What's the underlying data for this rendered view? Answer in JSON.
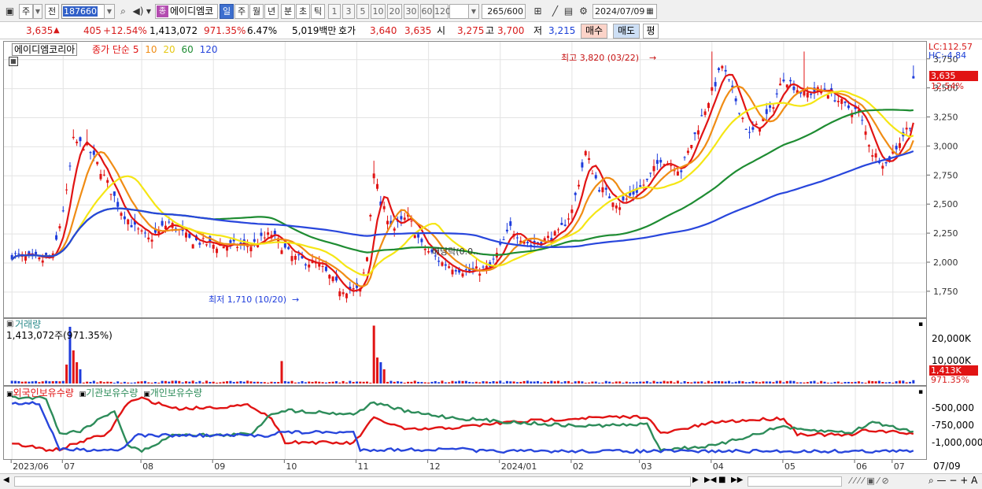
{
  "toolbar": {
    "mode_primary": "주",
    "mode_prev": "전",
    "stock_code": "187660",
    "stock_name": "에이디엠코",
    "stock_badge": "종",
    "periods": [
      "일",
      "주",
      "월",
      "년",
      "분",
      "초",
      "틱"
    ],
    "active_period": "일",
    "intervals": [
      "1",
      "3",
      "5",
      "10",
      "20",
      "30",
      "60",
      "120"
    ],
    "count_value": "265",
    "count_max": "/600",
    "date": "2024/07/09"
  },
  "quote": {
    "price": "3,635",
    "change_arrow": "▲",
    "change": "405",
    "change_pct": "+12.54%",
    "volume": "1,413,072",
    "volume_ratio": "971.35%",
    "turnover": "6.47%",
    "amount": "5,019백만",
    "bid_label": "호가",
    "bid1": "3,640",
    "bid2": "3,635",
    "open_label": "시",
    "open": "3,275",
    "high_label": "고",
    "high": "3,700",
    "low_label": "저",
    "low": "3,215",
    "buy_label": "매수",
    "sell_label": "매도",
    "eval_label": "평"
  },
  "price_panel": {
    "name_tag": "에이디엠코리아",
    "ma_title": "종가 단순",
    "ma_periods": [
      "5",
      "10",
      "20",
      "60",
      "120"
    ],
    "high_annotation": "최고 3,820 (03/22)",
    "low_annotation": "최저 1,710 (10/20)",
    "dividend_annotation": "배당락(0.0...",
    "lc_label": "LC:112.57",
    "hc_label": "HC:-4.84",
    "current_price_tag": "3,635",
    "current_pct_tag": "12.54%",
    "y_ticks": [
      "3,750",
      "3,500",
      "3,250",
      "3,000",
      "2,750",
      "2,500",
      "2,250",
      "2,000",
      "1,750"
    ]
  },
  "volume_panel": {
    "title": "거래량",
    "value": "1,413,072주(971.35%)",
    "y_ticks": [
      "20,000K",
      "10,000K"
    ],
    "current_tag": "1,413K",
    "current_pct_tag": "971.35%"
  },
  "holdings_panel": {
    "series": [
      "외국인보유수량",
      "기관보유수량",
      "개인보유수량"
    ],
    "y_ticks": [
      "-500,000",
      "-750,000",
      "-1,000,000"
    ]
  },
  "x_axis": {
    "labels": [
      "2023/06",
      "07",
      "08",
      "09",
      "10",
      "11",
      "12",
      "2024/01",
      "02",
      "03",
      "04",
      "05",
      "06",
      "07"
    ],
    "right_label": "07/09"
  },
  "colors": {
    "ma5": "#e11414",
    "ma10": "#f08c14",
    "ma20": "#f5e614",
    "ma60": "#1e8c32",
    "ma120": "#2846dc",
    "up": "#e11414",
    "down": "#1e3cdc",
    "foreign": "#e11414",
    "institution": "#2d8c5a",
    "individual": "#2846dc"
  }
}
